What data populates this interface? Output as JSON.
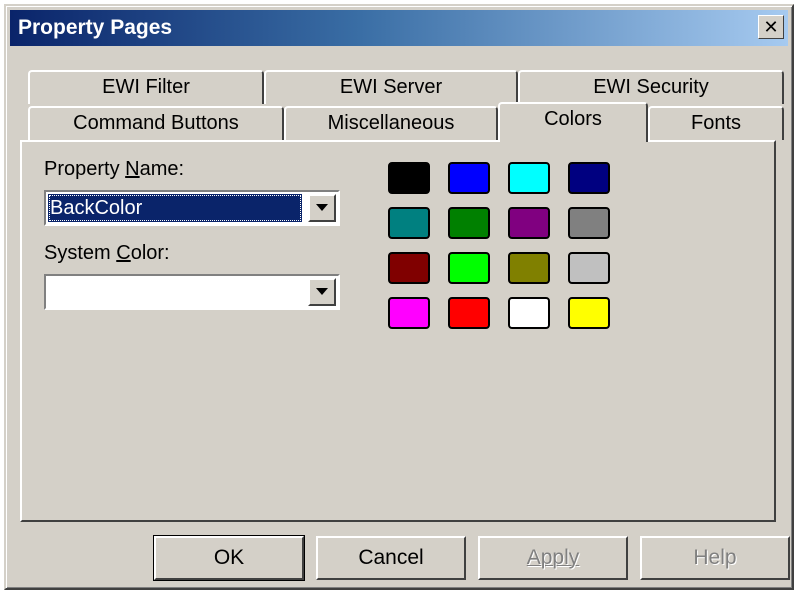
{
  "window": {
    "title": "Property Pages",
    "close_glyph": "✕"
  },
  "tabs": {
    "row_back": [
      {
        "label": "EWI Filter"
      },
      {
        "label": "EWI Server"
      },
      {
        "label": "EWI Security"
      }
    ],
    "row_front": [
      {
        "label": "Command Buttons"
      },
      {
        "label": "Miscellaneous"
      },
      {
        "label": "Colors",
        "selected": true
      },
      {
        "label": "Fonts"
      }
    ]
  },
  "form": {
    "property_name_label_pre": "Property ",
    "property_name_label_accel": "N",
    "property_name_label_post": "ame:",
    "property_name_value": "BackColor",
    "system_color_label_pre": "System ",
    "system_color_label_accel": "C",
    "system_color_label_post": "olor:",
    "system_color_value": ""
  },
  "palette": {
    "colors": [
      "#000000",
      "#0000ff",
      "#00ffff",
      "#000080",
      "#008080",
      "#008000",
      "#800080",
      "#808080",
      "#800000",
      "#00ff00",
      "#808000",
      "#c0c0c0",
      "#ff00ff",
      "#ff0000",
      "#ffffff",
      "#ffff00"
    ]
  },
  "buttons": {
    "ok": "OK",
    "cancel": "Cancel",
    "apply": "Apply",
    "help": "Help"
  },
  "icons": {
    "close": "close-icon",
    "dropdown": "chevron-down-icon"
  }
}
